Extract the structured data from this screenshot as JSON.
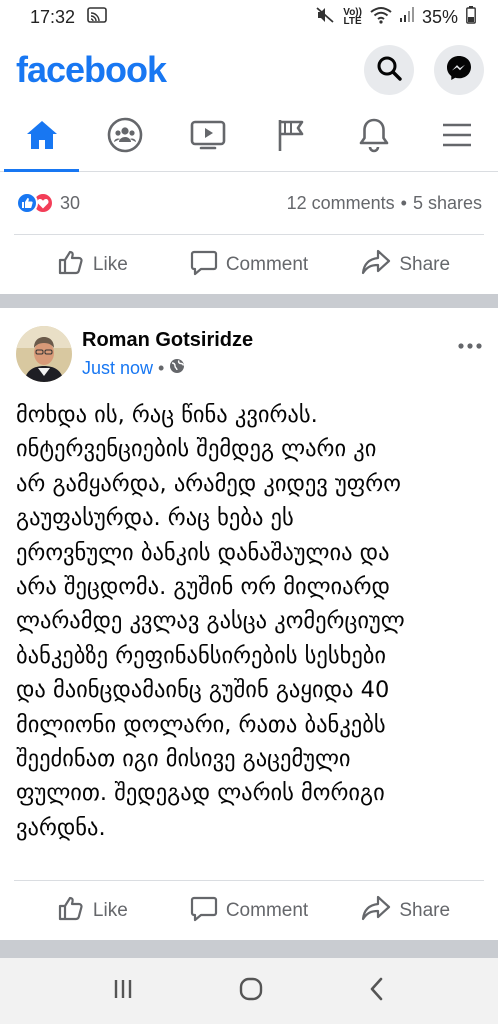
{
  "status_bar": {
    "time": "17:32",
    "battery": "35%",
    "net_top": "Vo))",
    "net_bottom": "LTE"
  },
  "header": {
    "logo": "facebook"
  },
  "nav": {
    "tabs": [
      {
        "name": "home",
        "icon": "home-icon",
        "active": true
      },
      {
        "name": "groups",
        "icon": "groups-icon",
        "active": false
      },
      {
        "name": "watch",
        "icon": "video-icon",
        "active": false
      },
      {
        "name": "pages",
        "icon": "flag-icon",
        "active": false
      },
      {
        "name": "notifications",
        "icon": "bell-icon",
        "active": false
      },
      {
        "name": "menu",
        "icon": "hamburger-icon",
        "active": false
      }
    ],
    "accent": "#1877f2"
  },
  "prev_post": {
    "reaction_count": "30",
    "comments": "12 comments",
    "separator": "•",
    "shares": "5 shares"
  },
  "actions": {
    "like": "Like",
    "comment": "Comment",
    "share": "Share"
  },
  "post": {
    "author": "Roman Gotsiridze",
    "time": "Just now",
    "separator": "•",
    "privacy_icon": "globe-icon",
    "text": "მოხდა ის, რაც წინა კვირას.\nინტერვენციების შემდეგ ლარი კი\nარ გამყარდა, არამედ კიდევ უფრო\nგაუფასურდა. რაც ხება ეს\nეროვნული ბანკის დანაშაულია და\nარა შეცდომა. გუშინ ორ მილიარდ\nლარამდე კვლავ გასცა კომერციულ\nბანკებზე რეფინანსირების სესხები\nდა მაინცდამაინც გუშინ გაყიდა 40\nმილიონი დოლარი, რათა ბანკებს\nშეეძინათ იგი მისივე გაცემული\nფულით. შედეგად ლარის მორიგი\nვარდნა."
  },
  "colors": {
    "brand": "#1877f2",
    "love": "#f33e58",
    "secondary_text": "#65676b"
  }
}
